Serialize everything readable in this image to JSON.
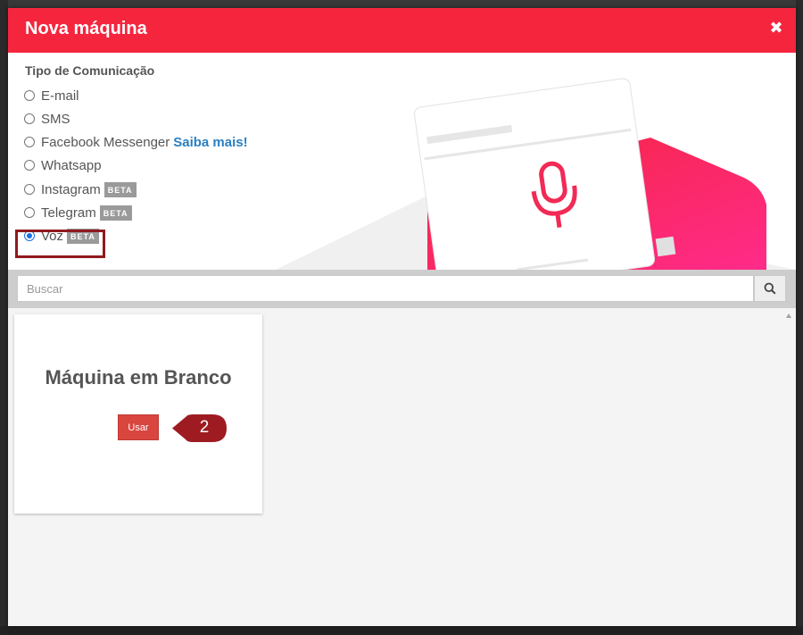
{
  "modal": {
    "title": "Nova máquina",
    "close_symbol": "✖"
  },
  "communication": {
    "label": "Tipo de Comunicação",
    "options": [
      {
        "label": "E-mail",
        "checked": false
      },
      {
        "label": "SMS",
        "checked": false
      },
      {
        "label": "Facebook Messenger",
        "link": "Saiba mais!",
        "checked": false
      },
      {
        "label": "Whatsapp",
        "checked": false
      },
      {
        "label": "Instagram",
        "badge": "BETA",
        "checked": false
      },
      {
        "label": "Telegram",
        "badge": "BETA",
        "checked": false
      },
      {
        "label": "Voz",
        "badge": "BETA",
        "checked": true
      }
    ]
  },
  "search": {
    "placeholder": "Buscar",
    "icon": "search-icon"
  },
  "card": {
    "title": "Máquina em Branco",
    "button_label": "Usar"
  },
  "callout": {
    "number": "2"
  },
  "colors": {
    "header": "#f5253e",
    "use_button": "#d9453f",
    "callout": "#9e1b22",
    "radio_checked": "#1a73e8",
    "link": "#2a7fc1"
  }
}
